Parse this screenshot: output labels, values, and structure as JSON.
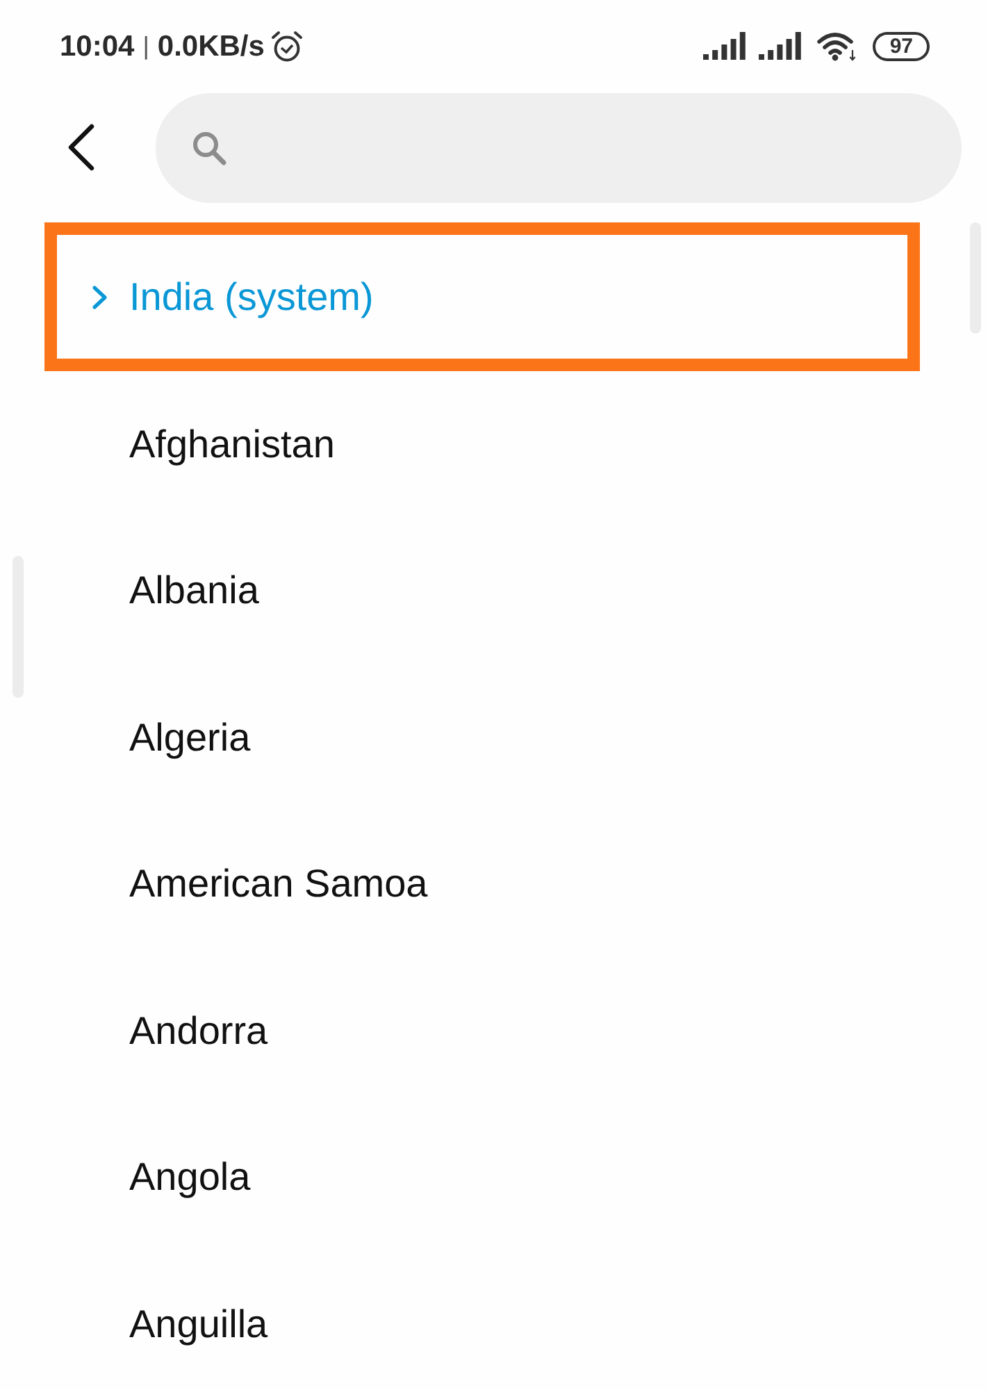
{
  "status_bar": {
    "time": "10:04",
    "separator": "|",
    "network_speed": "0.0KB/s",
    "battery": "97"
  },
  "countries": [
    {
      "label": "India (system)",
      "selected": true,
      "highlighted": true
    },
    {
      "label": "Afghanistan",
      "selected": false,
      "highlighted": false
    },
    {
      "label": "Albania",
      "selected": false,
      "highlighted": false
    },
    {
      "label": "Algeria",
      "selected": false,
      "highlighted": false
    },
    {
      "label": "American Samoa",
      "selected": false,
      "highlighted": false
    },
    {
      "label": "Andorra",
      "selected": false,
      "highlighted": false
    },
    {
      "label": "Angola",
      "selected": false,
      "highlighted": false
    },
    {
      "label": "Anguilla",
      "selected": false,
      "highlighted": false
    }
  ]
}
